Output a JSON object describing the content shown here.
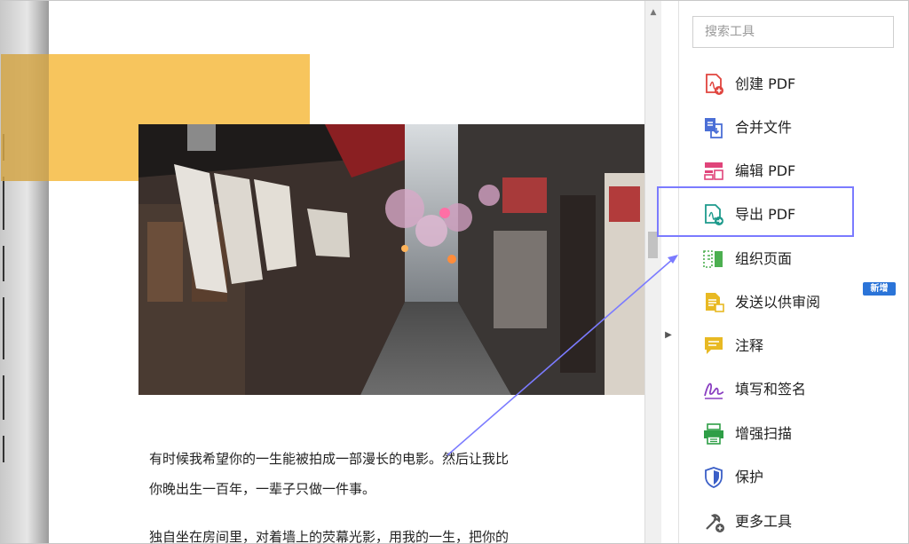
{
  "document": {
    "paragraphs": [
      "有时候我希望你的一生能被拍成一部漫长的电影。然后让我比",
      "你晚出生一百年，一辈子只做一件事。",
      "独自坐在房间里，对着墙上的荧幕光影，用我的一生，把你的"
    ]
  },
  "tools_panel": {
    "search": {
      "placeholder": "搜索工具",
      "value": ""
    },
    "items": [
      {
        "label": "创建 PDF",
        "icon": "create-pdf-icon",
        "color": "#e0443e"
      },
      {
        "label": "合并文件",
        "icon": "combine-files-icon",
        "color": "#4b6fd6"
      },
      {
        "label": "编辑 PDF",
        "icon": "edit-pdf-icon",
        "color": "#e0447a"
      },
      {
        "label": "导出 PDF",
        "icon": "export-pdf-icon",
        "color": "#1d9a8c"
      },
      {
        "label": "组织页面",
        "icon": "organize-pages-icon",
        "color": "#4caf50"
      },
      {
        "label": "发送以供审阅",
        "icon": "send-review-icon",
        "color": "#e8b923"
      },
      {
        "label": "注释",
        "icon": "comment-icon",
        "color": "#e8b923"
      },
      {
        "label": "填写和签名",
        "icon": "fill-sign-icon",
        "color": "#8a3fc1"
      },
      {
        "label": "增强扫描",
        "icon": "enhance-scan-icon",
        "color": "#2e9e46"
      },
      {
        "label": "保护",
        "icon": "protect-icon",
        "color": "#3b5fc7"
      },
      {
        "label": "更多工具",
        "icon": "more-tools-icon",
        "color": "#555555"
      }
    ],
    "new_badge": "新增"
  },
  "colors": {
    "highlight": "#7b7bff",
    "accent_yellow": "#f7c55d",
    "badge_blue": "#2b74d8"
  }
}
